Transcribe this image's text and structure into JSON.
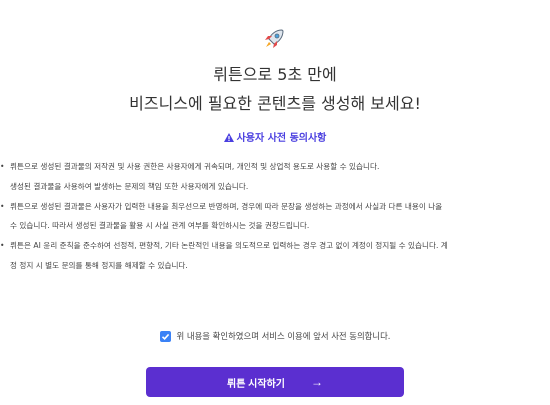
{
  "header": {
    "line1": "뤼튼으로 5초 만에",
    "line2": "비즈니스에 필요한 콘텐츠를 생성해 보세요!"
  },
  "consent": {
    "title": "사용자 사전 동의사항",
    "items": [
      "뤼튼으로 생성된 결과물의 저작권 및 사용 권한은 사용자에게 귀속되며, 개인적 및 상업적 용도로 사용할 수 있습니다.",
      "생성된 결과물을 사용하여 발생하는 문제의 책임 또한 사용자에게 있습니다.",
      "뤼튼으로 생성된 결과물은 사용자가 입력한 내용을 최우선으로 반영하며, 경우에 따라 문장을 생성하는 과정에서 사실과 다른 내용이 나올",
      "수 있습니다. 따라서 생성된 결과물을 활용 시 사실 관계 여부를 확인하시는 것을 권장드립니다.",
      "뤼튼은 AI 윤리 준칙을 준수하여 선정적, 편향적, 기타 논란적인 내용을 의도적으로 입력하는 경우 경고 없이 계정이 정지될 수 있습니다. 계",
      "정 정지 시 별도 문의를 통해 정지를 해제할 수 있습니다."
    ]
  },
  "agree": {
    "checked": true,
    "label": "위 내용을 확인하였으며 서비스 이용에 앞서 사전 동의합니다."
  },
  "start_button": {
    "label": "뤼튼 시작하기",
    "arrow": "→"
  },
  "colors": {
    "accent": "#5b2fd0",
    "consent_title": "#4a3fe0",
    "checkbox": "#3b82f6"
  }
}
